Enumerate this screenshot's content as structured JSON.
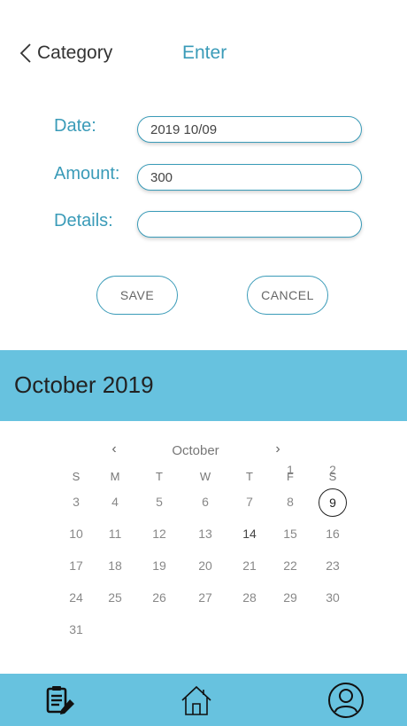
{
  "header": {
    "back_label": "Category",
    "title": "Enter"
  },
  "form": {
    "date_label": "Date:",
    "date_value": "2019 10/09",
    "amount_label": "Amount:",
    "amount_value": "300",
    "details_label": "Details:",
    "details_value": ""
  },
  "buttons": {
    "save": "SAVE",
    "cancel": "CANCEL"
  },
  "calendar": {
    "banner": "October 2019",
    "month_name": "October",
    "prev": "‹",
    "next": "›",
    "weekdays": [
      "S",
      "M",
      "T",
      "W",
      "T",
      "F",
      "S"
    ],
    "days": [
      "1",
      "2",
      "3",
      "4",
      "5",
      "6",
      "7",
      "8",
      "9",
      "10",
      "11",
      "12",
      "13",
      "14",
      "15",
      "16",
      "17",
      "18",
      "19",
      "20",
      "21",
      "22",
      "23",
      "24",
      "25",
      "26",
      "27",
      "28",
      "29",
      "30",
      "31"
    ],
    "selected_day": "9"
  },
  "nav": {
    "icons": [
      "notes-edit-icon",
      "home-icon",
      "profile-icon"
    ]
  },
  "colors": {
    "accent": "#3a9bb8",
    "banner": "#67c2df"
  }
}
